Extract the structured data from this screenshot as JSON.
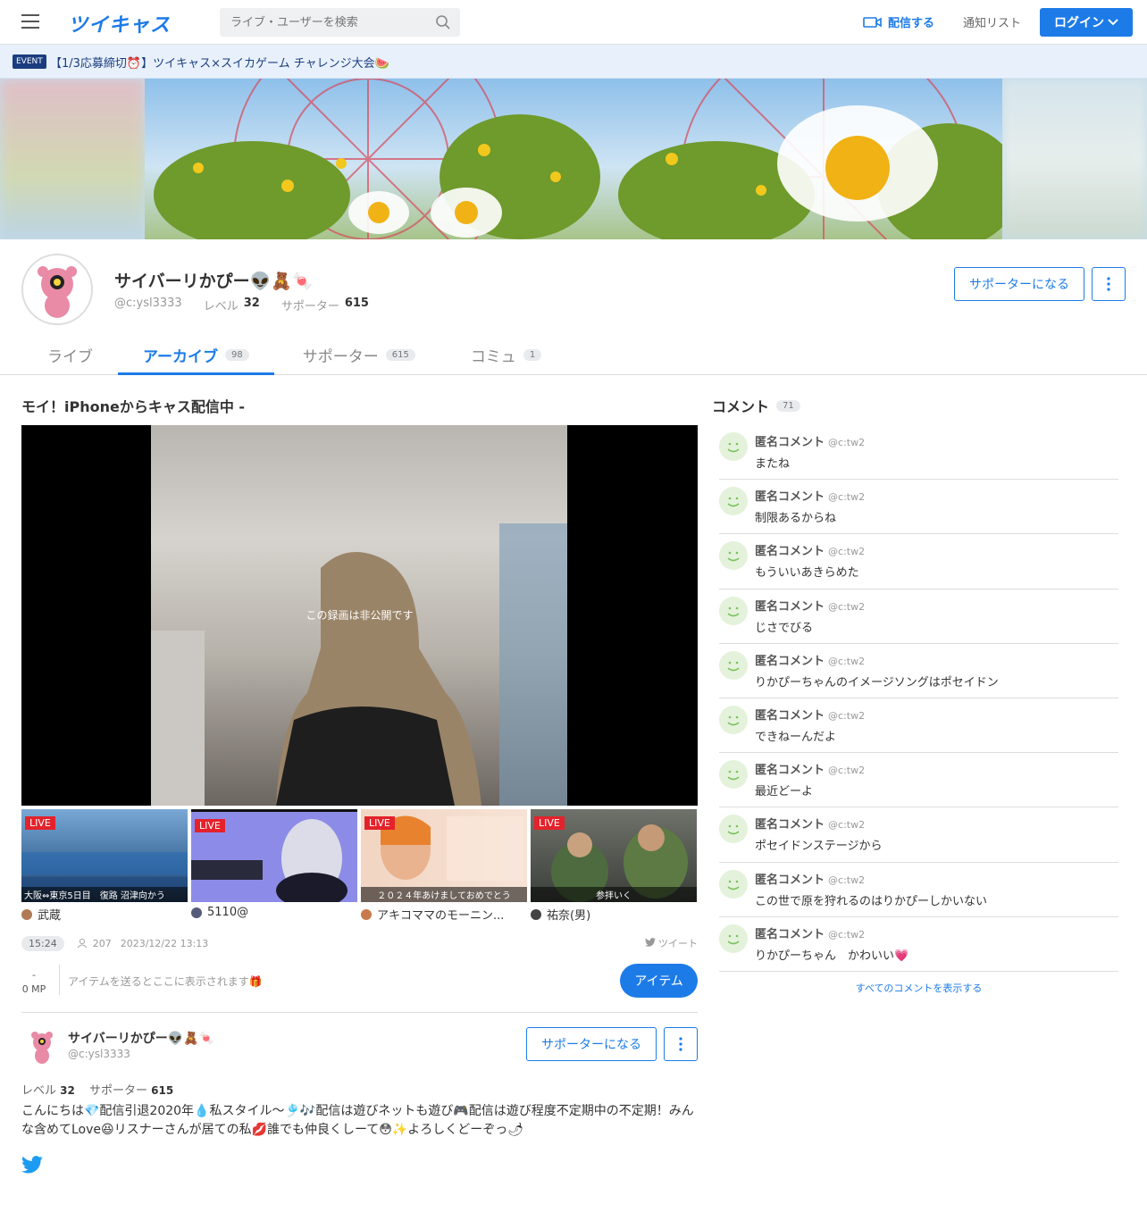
{
  "header": {
    "logo": "ツイキャス",
    "search_placeholder": "ライブ・ユーザーを検索",
    "broadcast_label": "配信する",
    "notify_label": "通知リスト",
    "login_label": "ログイン"
  },
  "event": {
    "tag": "EVENT",
    "text": "【1/3応募締切⏰】ツイキャス×スイカゲーム チャレンジ大会🍉"
  },
  "profile": {
    "name": "サイバーリかぴー👽🧸🍬",
    "user_id": "@c:ysl3333",
    "level_label": "レベル",
    "level": "32",
    "supporter_label": "サポーター",
    "supporters": "615",
    "support_button": "サポーターになる"
  },
  "tabs": [
    {
      "label": "ライブ",
      "count": ""
    },
    {
      "label": "アーカイブ",
      "count": "98"
    },
    {
      "label": "サポーター",
      "count": "615"
    },
    {
      "label": "コミュ",
      "count": "1"
    }
  ],
  "movie": {
    "title": "モイ！iPhoneからキャス配信中 -",
    "private_text": "この録画は非公開です",
    "duration": "15:24",
    "views": "207",
    "datetime": "2023/12/22 13:13",
    "tweet_label": "ツイート"
  },
  "live_items": [
    {
      "badge": "LIVE",
      "caption": "大阪⇔東京5日目　復路 沼津向かう",
      "name": "武蔵"
    },
    {
      "badge": "LIVE",
      "caption": "",
      "name": "5110@"
    },
    {
      "badge": "LIVE",
      "caption": "２０２４年あけましておめでとう",
      "name": "アキコママのモーニン..."
    },
    {
      "badge": "LIVE",
      "caption": "参拝いく",
      "name": "祐奈(男)"
    }
  ],
  "items": {
    "dash": "-",
    "mp": "0 MP",
    "note": "アイテムを送るとここに表示されます🎁",
    "button": "アイテム"
  },
  "user_block": {
    "name": "サイバーリかぴー👽🧸🍬",
    "user_id": "@c:ysl3333",
    "support_button": "サポーターになる",
    "level_label": "レベル",
    "level": "32",
    "supporter_label": "サポーター",
    "supporters": "615",
    "description": "こんにちは💎配信引退2020年💧私スタイル〜🎐🎶配信は遊びネットも遊び🎮配信は遊び程度不定期中の不定期！みんな含めてLove😆リスナーさんが居ての私💋誰でも仲良くしーて😳✨よろしくどーぞっ🌶"
  },
  "comments": {
    "title": "コメント",
    "count": "71",
    "more": "すべてのコメントを表示する",
    "list": [
      {
        "name": "匿名コメント",
        "id": "@c:tw2",
        "text": "またね"
      },
      {
        "name": "匿名コメント",
        "id": "@c:tw2",
        "text": "制限あるからね"
      },
      {
        "name": "匿名コメント",
        "id": "@c:tw2",
        "text": "もういいあきらめた"
      },
      {
        "name": "匿名コメント",
        "id": "@c:tw2",
        "text": "じさでびる"
      },
      {
        "name": "匿名コメント",
        "id": "@c:tw2",
        "text": "りかぴーちゃんのイメージソングはポセイドン"
      },
      {
        "name": "匿名コメント",
        "id": "@c:tw2",
        "text": "できねーんだよ"
      },
      {
        "name": "匿名コメント",
        "id": "@c:tw2",
        "text": "最近どーよ"
      },
      {
        "name": "匿名コメント",
        "id": "@c:tw2",
        "text": "ポセイドンステージから"
      },
      {
        "name": "匿名コメント",
        "id": "@c:tw2",
        "text": "この世で原を狩れるのはりかぴーしかいない"
      },
      {
        "name": "匿名コメント",
        "id": "@c:tw2",
        "text": "りかぴーちゃん　かわいい💗"
      }
    ]
  },
  "colors": {
    "accent": "#1d7be8",
    "live": "#e3222b",
    "event_bg": "#e8f1fb"
  }
}
